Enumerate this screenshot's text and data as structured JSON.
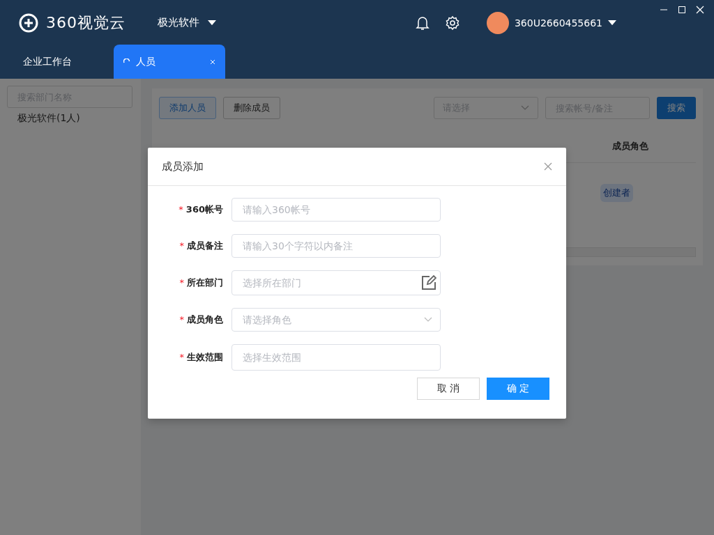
{
  "app": {
    "logo": "360视觉云",
    "org": "极光软件",
    "user": "360U2660455661"
  },
  "tabs": [
    {
      "label": "企业工作台",
      "selected": false,
      "closable": false
    },
    {
      "label": "人员",
      "selected": true,
      "closable": true
    }
  ],
  "sidebar": {
    "search_placeholder": "搜索部门名称",
    "items": [
      {
        "label": "极光软件(1人)",
        "selected": false
      }
    ]
  },
  "toolbar": {
    "buttons": [
      {
        "label": "添加人员",
        "kind": "primary-outline"
      },
      {
        "label": "删除成员",
        "kind": "default"
      }
    ],
    "filter_placeholder": "请选择",
    "search_placeholder": "搜索帐号/备注",
    "search_button": "搜索"
  },
  "table": {
    "columns": [
      "成员角色"
    ],
    "rows": [
      {
        "role": "创建者"
      }
    ]
  },
  "dialog": {
    "title": "成员添加",
    "required_mark": "*",
    "fields": [
      {
        "label": "360帐号",
        "required": true,
        "kind": "text",
        "placeholder": "请输入360帐号"
      },
      {
        "label": "成员备注",
        "required": true,
        "kind": "text",
        "placeholder": "请输入30个字符以内备注"
      },
      {
        "label": "所在部门",
        "required": true,
        "kind": "picker",
        "placeholder": "选择所在部门"
      },
      {
        "label": "成员角色",
        "required": true,
        "kind": "select",
        "placeholder": "请选择角色"
      },
      {
        "label": "生效范围",
        "required": true,
        "kind": "text",
        "placeholder": "选择生效范围"
      }
    ],
    "cancel": "取 消",
    "confirm": "确 定"
  }
}
